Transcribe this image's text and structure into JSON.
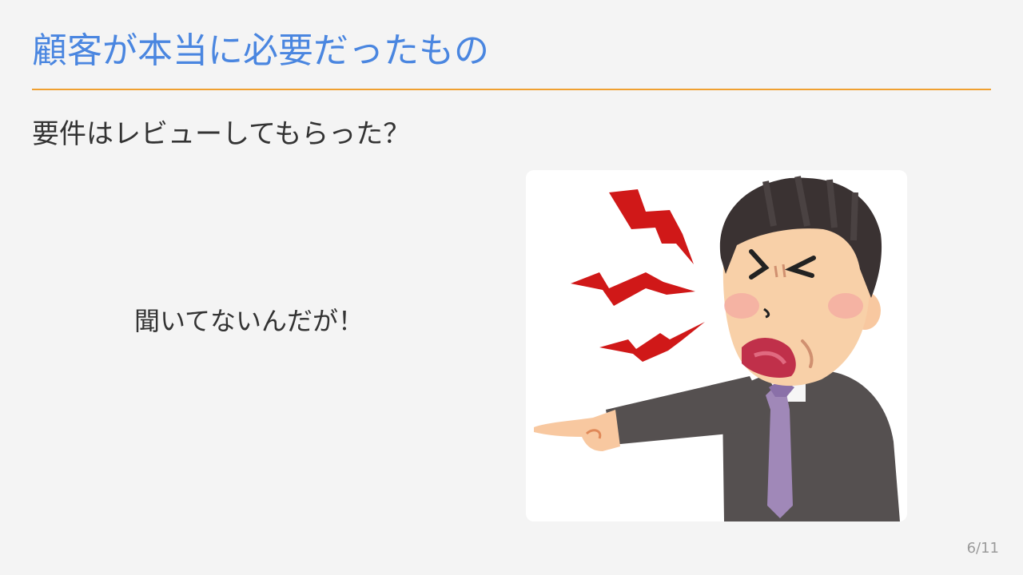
{
  "slide": {
    "title": "顧客が本当に必要だったもの",
    "subtitle": "要件はレビューしてもらった？",
    "speech": "聞いてないんだが！",
    "page_number": "6/11"
  },
  "illustration": {
    "icon": "angry-businessman-pointing",
    "colors": {
      "anger_marks": "#d01818",
      "hair": "#3a3232",
      "skin": "#f8d0a8",
      "suit": "#555050",
      "tie": "#a088b8",
      "mouth": "#c0304a"
    }
  },
  "colors": {
    "title": "#4a86e0",
    "rule": "#f0a030",
    "text": "#333333",
    "background": "#f4f4f4"
  }
}
